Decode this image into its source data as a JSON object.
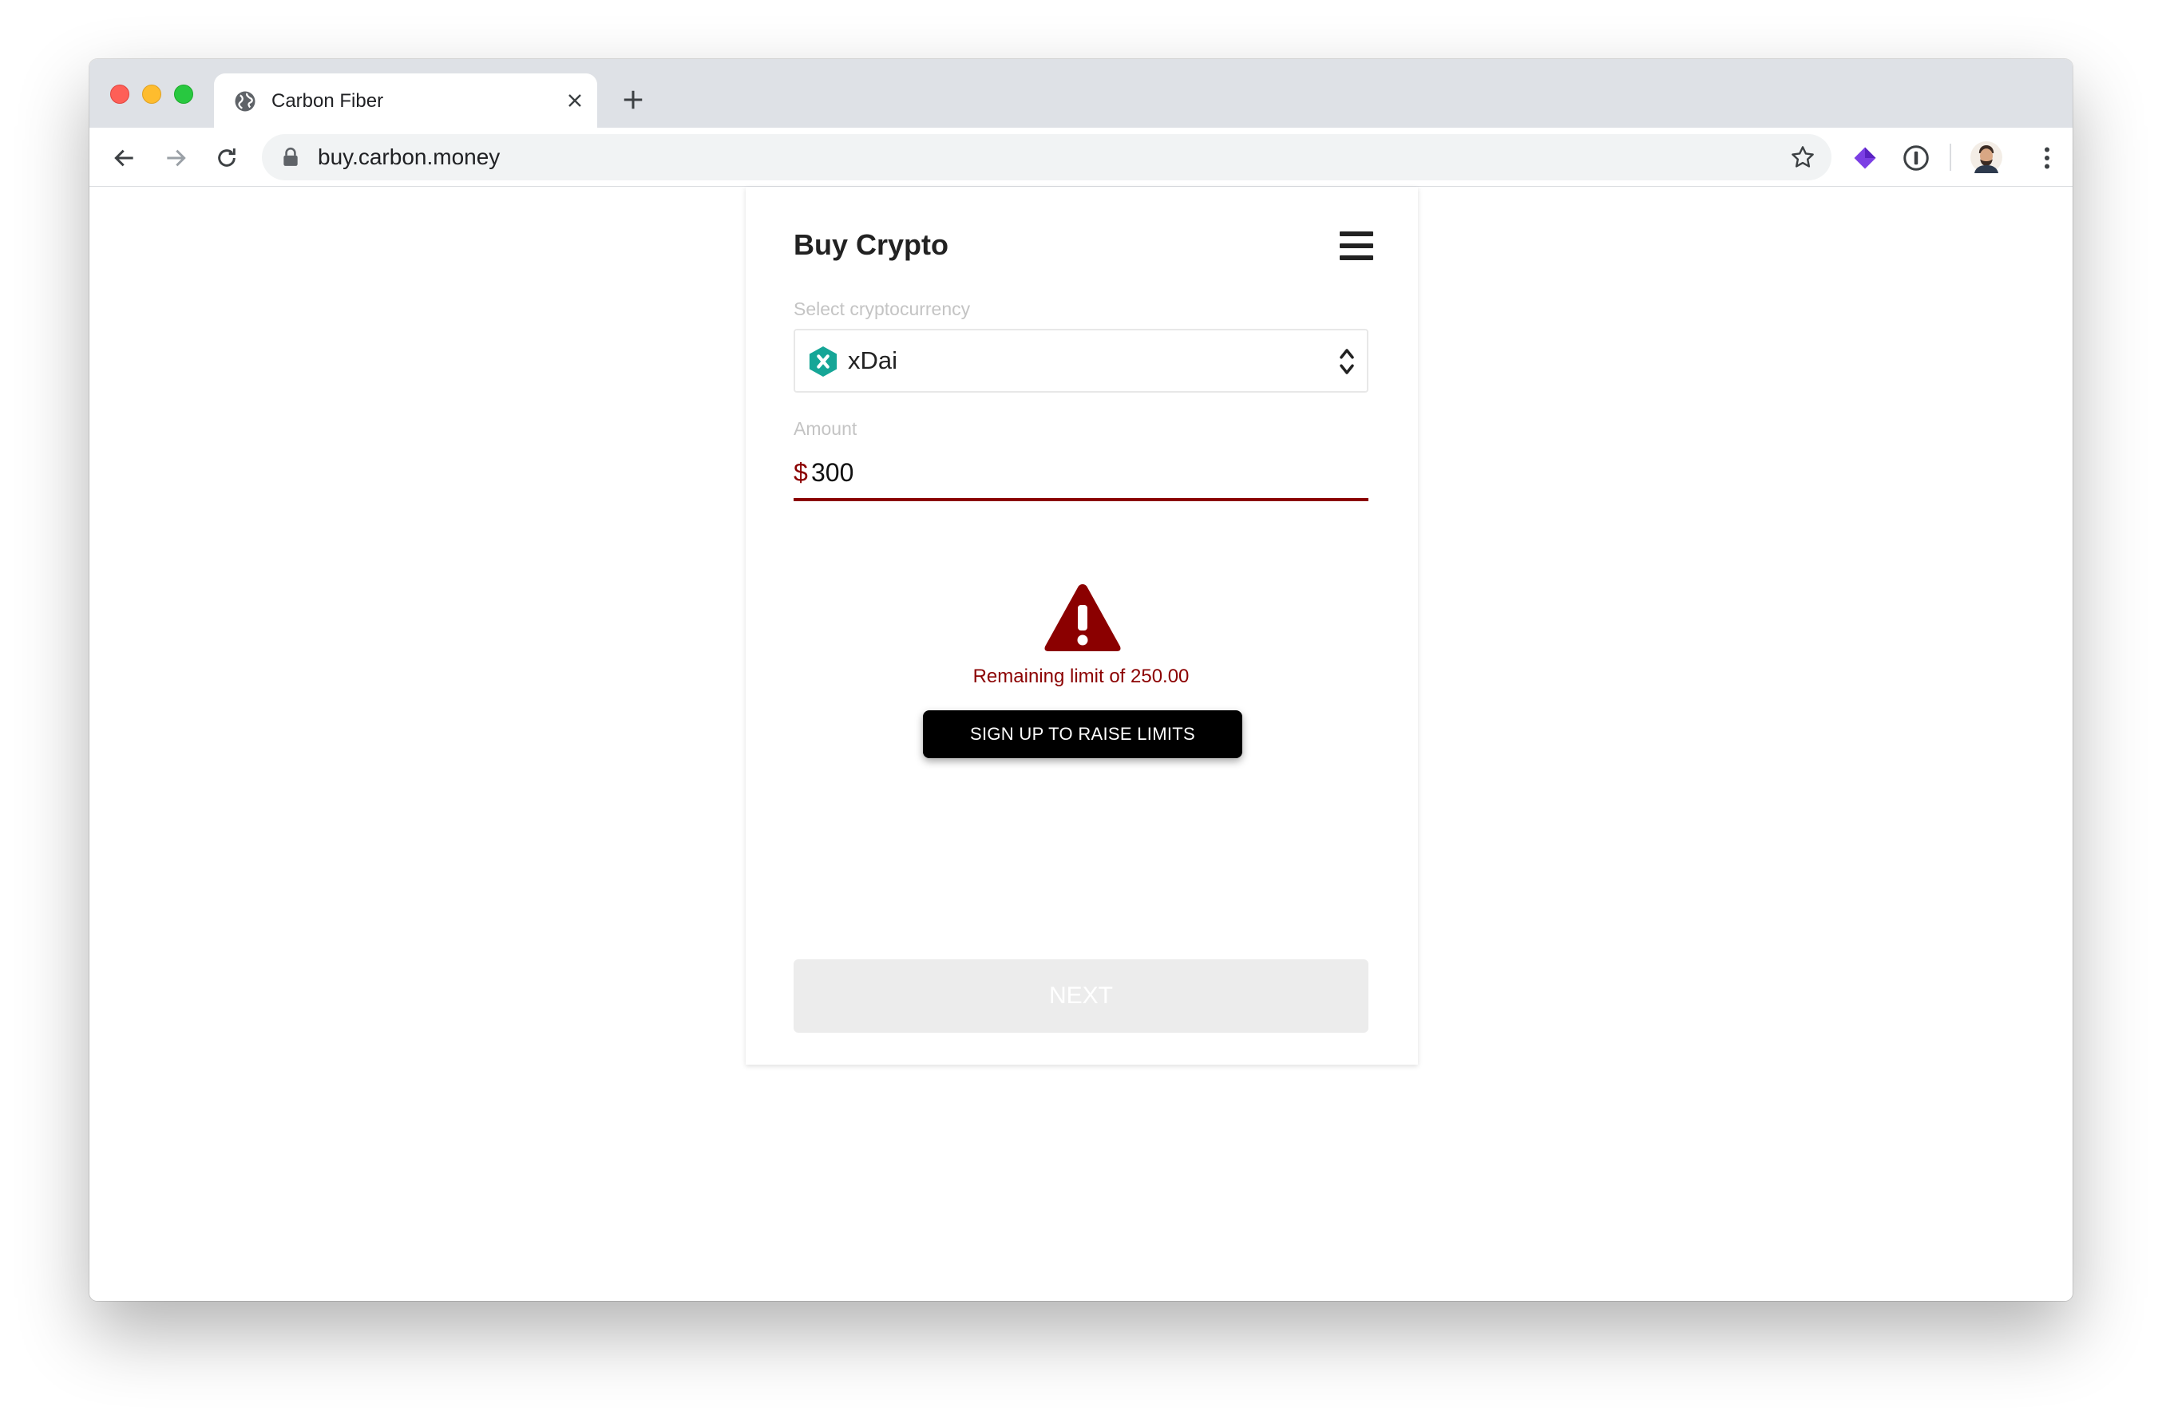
{
  "browser": {
    "tab_title": "Carbon Fiber",
    "url": "buy.carbon.money"
  },
  "card": {
    "title": "Buy Crypto",
    "select_label": "Select cryptocurrency",
    "selected_currency": "xDai",
    "amount_label": "Amount",
    "currency_symbol": "$",
    "amount_value": "300",
    "warning_text": "Remaining limit of 250.00",
    "signup_label": "SIGN UP TO RAISE LIMITS",
    "next_label": "NEXT"
  },
  "colors": {
    "error": "#8b0000",
    "coin": "#16a697",
    "button_dark": "#000000",
    "button_disabled": "#ececec"
  }
}
